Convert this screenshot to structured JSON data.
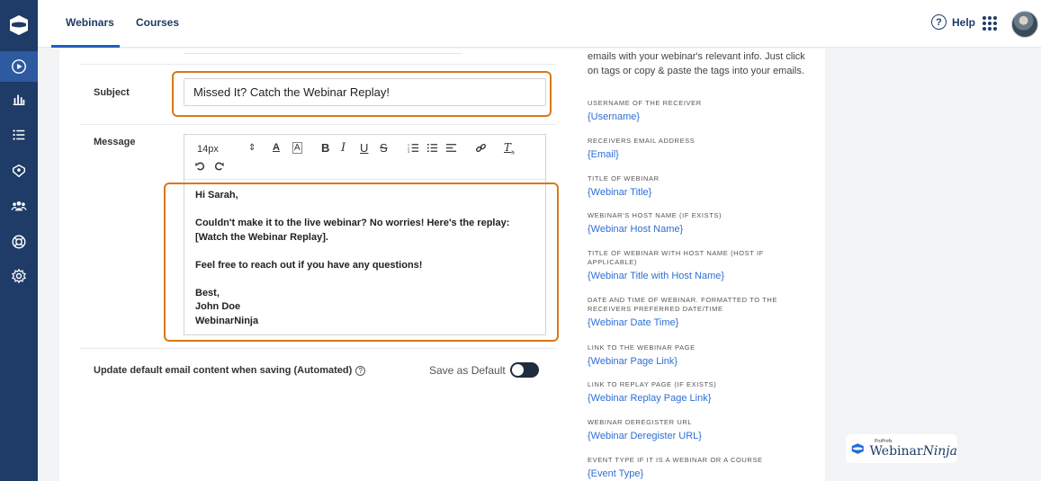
{
  "topbar": {
    "tabs": [
      {
        "label": "Webinars"
      },
      {
        "label": "Courses"
      }
    ],
    "help_label": "Help"
  },
  "form": {
    "subject_label": "Subject",
    "subject_value": "Missed It? Catch the Webinar Replay!",
    "message_label": "Message",
    "font_size": "14px",
    "message": {
      "greeting": "Hi Sarah,",
      "para1": "Couldn't make it to the live webinar? No worries! Here's the replay: [Watch the Webinar Replay].",
      "para2": "Feel free to reach out if you have any questions!",
      "sign_off": "Best,",
      "name": "John Doe",
      "company": "WebinarNinja"
    },
    "update_label": "Update default email content when saving (Automated)",
    "save_default_label": "Save as Default"
  },
  "tags": {
    "intro": "emails with your webinar's relevant info. Just click on tags or copy & paste the tags into your emails.",
    "items": [
      {
        "title": "USERNAME OF THE RECEIVER",
        "tag": "{Username}"
      },
      {
        "title": "RECEIVERS EMAIL ADDRESS",
        "tag": "{Email}"
      },
      {
        "title": "TITLE OF WEBINAR",
        "tag": "{Webinar Title}"
      },
      {
        "title": "WEBINAR'S HOST NAME (IF EXISTS)",
        "tag": "{Webinar Host Name}"
      },
      {
        "title": "TITLE OF WEBINAR WITH HOST NAME (HOST IF APPLICABLE)",
        "tag": "{Webinar Title with Host Name}"
      },
      {
        "title": "DATE AND TIME OF WEBINAR. FORMATTED TO THE RECEIVERS PREFERRED DATE/TIME",
        "tag": "{Webinar Date Time}"
      },
      {
        "title": "LINK TO THE WEBINAR PAGE",
        "tag": "{Webinar Page Link}"
      },
      {
        "title": "LINK TO REPLAY PAGE (IF EXISTS)",
        "tag": "{Webinar Replay Page Link}"
      },
      {
        "title": "WEBINAR DEREGISTER URL",
        "tag": "{Webinar Deregister URL}"
      },
      {
        "title": "EVENT TYPE IF IT IS A WEBINAR OR A COURSE",
        "tag": "{Event Type}"
      }
    ]
  },
  "brand": {
    "small": "ProProfs",
    "name_part1": "Webinar",
    "name_part2": "Ninja"
  },
  "colors": {
    "sidebar": "#1f3b67",
    "accent": "#2d6fd6",
    "highlight": "#d97818"
  }
}
